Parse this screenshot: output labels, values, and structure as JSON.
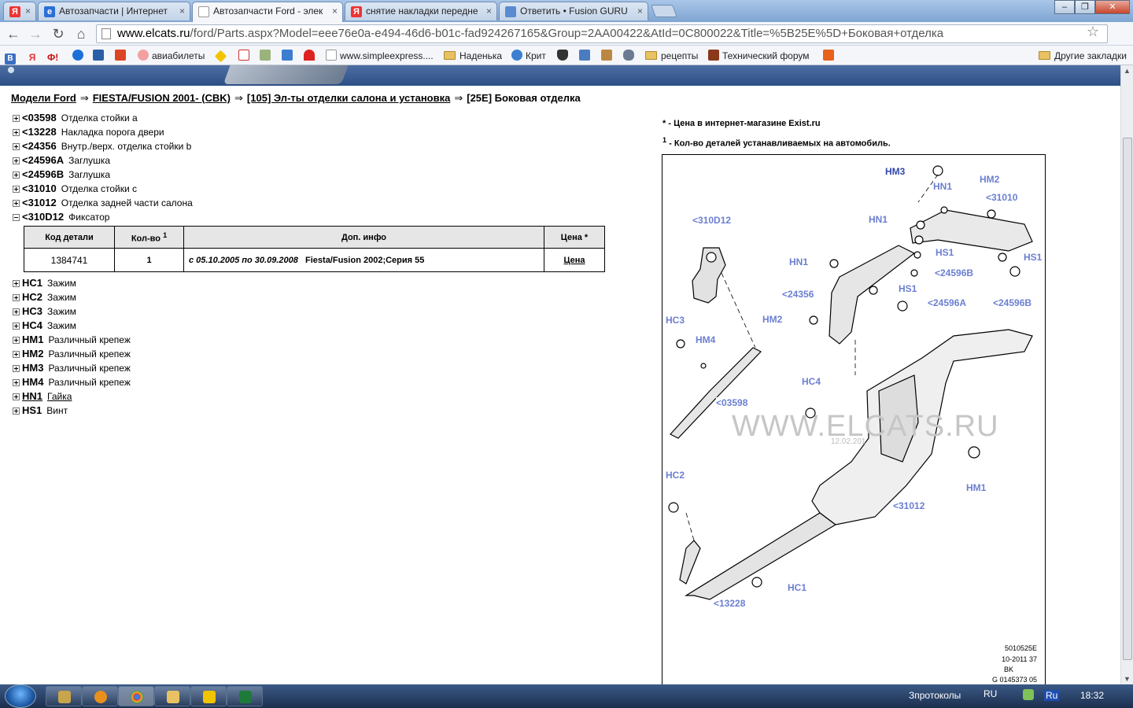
{
  "browser": {
    "tabs": [
      {
        "label": "Я",
        "icon": "yandex-icon"
      },
      {
        "label": "Автозапчасти | Интернет",
        "icon": "site-icon"
      },
      {
        "label": "Автозапчасти Ford - элек",
        "icon": "page-icon",
        "active": true
      },
      {
        "label": "снятие накладки передне",
        "icon": "yandex-icon"
      },
      {
        "label": "Ответить • Fusion GURU",
        "icon": "forum-icon"
      }
    ],
    "url_host": "www.elcats.ru",
    "url_rest": "/ford/Parts.aspx?Model=eee76e0a-e494-46d6-b01c-fad924267165&Group=2AA00422&AtId=0C800022&Title=%5B25E%5D+Боковая+отделка",
    "bookmarks": [
      "авиабилеты",
      "www.simpleexpress....",
      "Наденька",
      "Крит",
      "рецепты",
      "Технический форум",
      "Другие закладки"
    ],
    "bookmark_icons": [
      "В",
      "Я",
      "Ф!"
    ]
  },
  "breadcrumb": {
    "items": [
      "Модели Ford",
      "FIESTA/FUSION 2001- (CBK)",
      "[105] Эл-ты отделки салона и установка"
    ],
    "current": "[25E] Боковая отделка",
    "separator": "⇒"
  },
  "tree": [
    {
      "code": "<03598",
      "name": "Отделка стойки а",
      "state": "collapsed"
    },
    {
      "code": "<13228",
      "name": "Накладка порога двери",
      "state": "collapsed"
    },
    {
      "code": "<24356",
      "name": "Внутр./верх. отделка стойки b",
      "state": "collapsed"
    },
    {
      "code": "<24596A",
      "name": "Заглушка",
      "state": "collapsed"
    },
    {
      "code": "<24596B",
      "name": "Заглушка",
      "state": "collapsed"
    },
    {
      "code": "<31010",
      "name": "Отделка стойки с",
      "state": "collapsed"
    },
    {
      "code": "<31012",
      "name": "Отделка задней части салона",
      "state": "collapsed"
    },
    {
      "code": "<310D12",
      "name": "Фиксатор",
      "state": "expanded"
    }
  ],
  "tree_after": [
    {
      "code": "HC1",
      "name": "Зажим"
    },
    {
      "code": "HC2",
      "name": "Зажим"
    },
    {
      "code": "HC3",
      "name": "Зажим"
    },
    {
      "code": "HC4",
      "name": "Зажим"
    },
    {
      "code": "HM1",
      "name": "Различный крепеж"
    },
    {
      "code": "HM2",
      "name": "Различный крепеж"
    },
    {
      "code": "HM3",
      "name": "Различный крепеж"
    },
    {
      "code": "HM4",
      "name": "Различный крепеж"
    },
    {
      "code": "HN1",
      "name": "Гайка",
      "link": true
    },
    {
      "code": "HS1",
      "name": "Винт"
    }
  ],
  "parts_table": {
    "headers": [
      "Код детали",
      "Кол-во",
      "Доп. инфо",
      "Цена *"
    ],
    "qty_sup": "1",
    "row": {
      "code": "1384741",
      "qty": "1",
      "dates": "с 05.10.2005 по 30.09.2008",
      "info": "Fiesta/Fusion 2002;Серия 55",
      "price": "Цена"
    }
  },
  "legend": {
    "price_mark": "*",
    "price_note": "- Цена в интернет-магазине Exist.ru",
    "qty_mark": "1",
    "qty_note": "- Кол-во деталей устанавливаемых на автомобиль."
  },
  "diagram": {
    "labels": [
      "HM3",
      "HN1",
      "HM2",
      "<31010",
      "<310D12",
      "HN1",
      "HS1",
      "HS1",
      "HN1",
      "<24596B",
      "<24356",
      "HS1",
      "<24596A",
      "<24596B",
      "HC3",
      "HM2",
      "HM4",
      "HC4",
      "<03598",
      "HC2",
      "<31012",
      "HM1",
      "HC1",
      "<13228"
    ],
    "watermark": "WWW.ELCATS.RU",
    "watermark_date": "12.02.201",
    "ref_lines": [
      "5010525E",
      "10-2011 37",
      "BK",
      "G 0145373 05"
    ]
  },
  "taskbar": {
    "tray_text": "Зпротоколы",
    "lang": "RU",
    "lang2": "Ru",
    "time": "18:32"
  }
}
